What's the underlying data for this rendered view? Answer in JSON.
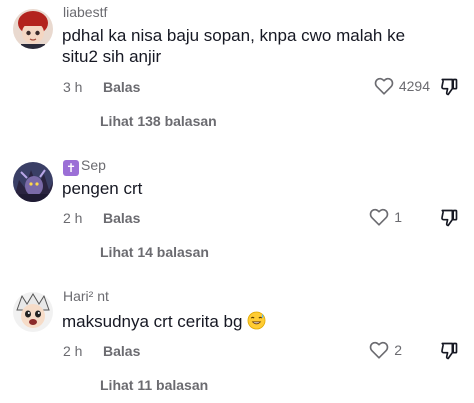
{
  "comments": [
    {
      "username": "liabestf",
      "text": "pdhal ka nisa baju sopan, knpa cwo malah ke situ2 sih anjir",
      "time": "3 h",
      "reply_label": "Balas",
      "like_count": "4294",
      "view_replies": "Lihat 138 balasan",
      "avatar_icon": "chibi-avatar-icon"
    },
    {
      "username_badge": "✝",
      "username": "Sep",
      "text": "pengen crt",
      "time": "2 h",
      "reply_label": "Balas",
      "like_count": "1",
      "view_replies": "Lihat 14 balasan",
      "avatar_icon": "dark-character-avatar-icon"
    },
    {
      "username": "Hari² nt",
      "text": "maksudnya crt cerita bg",
      "text_emoji": "laughing-sweat-emoji",
      "time": "2 h",
      "reply_label": "Balas",
      "like_count": "2",
      "view_replies": "Lihat 11 balasan",
      "avatar_icon": "anime-avatar-icon"
    }
  ],
  "colors": {
    "text": "#161823",
    "muted": "#6b6b70",
    "background": "#ffffff"
  }
}
